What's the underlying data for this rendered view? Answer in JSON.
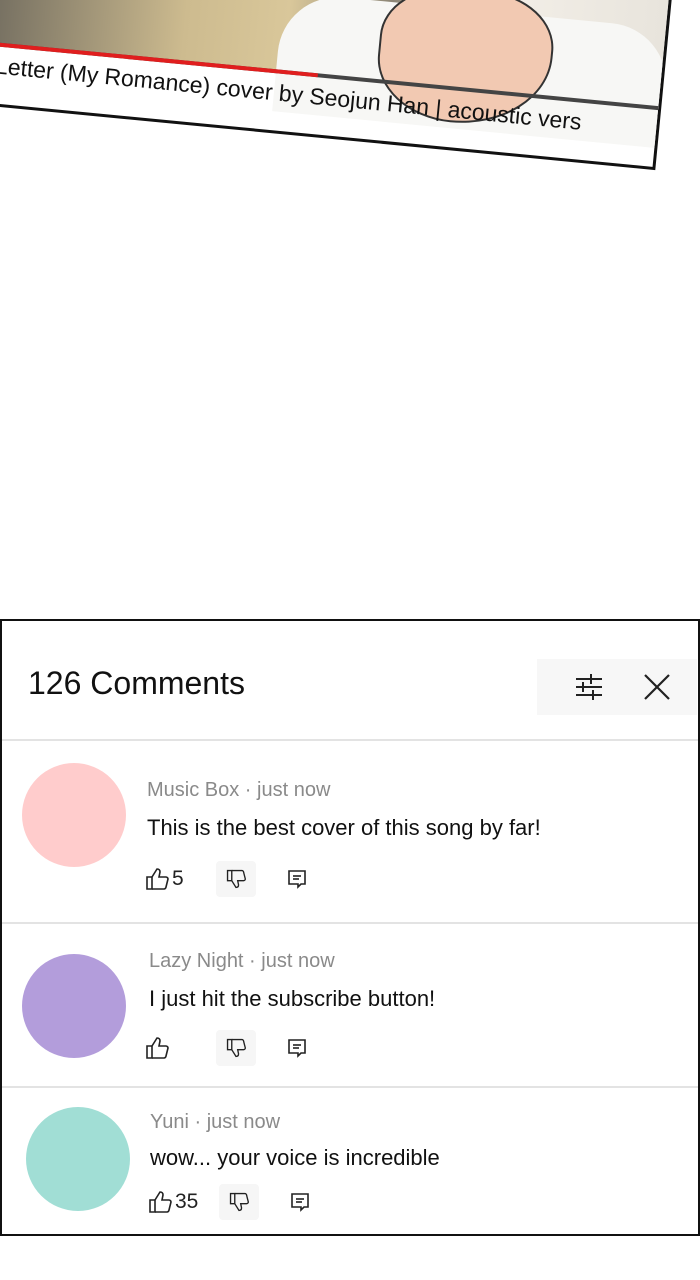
{
  "video": {
    "title": "Letter (My Romance) cover by Seojun Han | acoustic vers",
    "progress_fraction": 0.5
  },
  "comments_panel": {
    "title": "126 Comments",
    "filter_icon": "sliders-icon",
    "close_icon": "close-icon",
    "items": [
      {
        "author": "Music Box",
        "time": "just now",
        "meta": "Music Box · just now",
        "text": "This is the best cover of this song by far!",
        "likes": "5",
        "avatar_color": "#ffcccc"
      },
      {
        "author": "Lazy Night",
        "time": "just now",
        "meta": "Lazy Night · just now",
        "text": "I just hit the subscribe button!",
        "likes": "",
        "avatar_color": "#b39ddb"
      },
      {
        "author": "Yuni",
        "time": "just now",
        "meta": "Yuni · just now",
        "text": "wow... your voice is incredible",
        "likes": "35",
        "avatar_color": "#a1ded5"
      }
    ]
  },
  "colors": {
    "progress": "#e01e1e",
    "meta_text": "#8a8a8a",
    "border": "#111111"
  }
}
